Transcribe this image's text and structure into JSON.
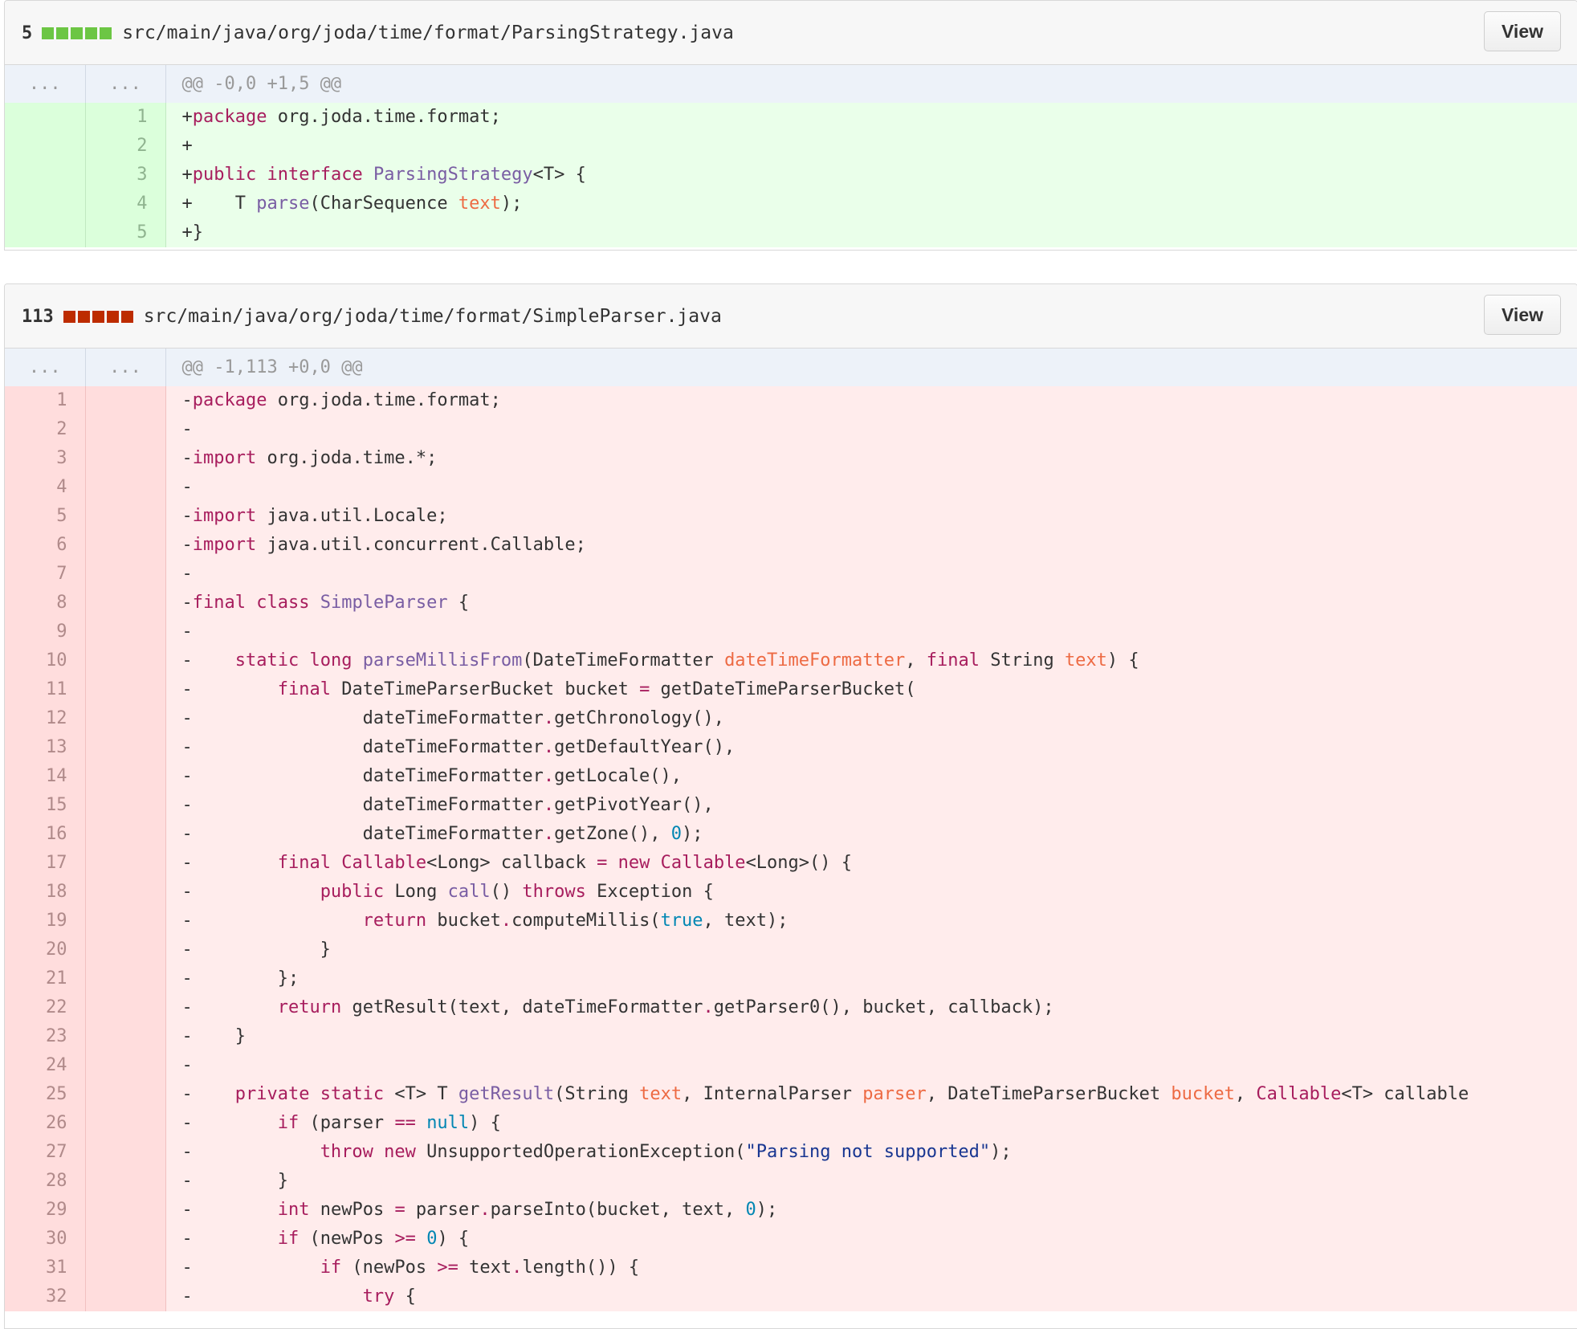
{
  "files": [
    {
      "count": "5",
      "path": "src/main/java/org/joda/time/format/ParsingStrategy.java",
      "view_label": "View",
      "block_color": "#6cc644",
      "hunk": "@@ -0,0 +1,5 @@",
      "hunk_old": "...",
      "hunk_new": "...",
      "lines": [
        {
          "old": "",
          "new": "1",
          "text": "+package org.joda.time.format;"
        },
        {
          "old": "",
          "new": "2",
          "text": "+"
        },
        {
          "old": "",
          "new": "3",
          "text": "+public interface ParsingStrategy<T> {"
        },
        {
          "old": "",
          "new": "4",
          "text": "+    T parse(CharSequence text);"
        },
        {
          "old": "",
          "new": "5",
          "text": "+}"
        }
      ]
    },
    {
      "count": "113",
      "path": "src/main/java/org/joda/time/format/SimpleParser.java",
      "view_label": "View",
      "block_color": "#bd2c00",
      "hunk": "@@ -1,113 +0,0 @@",
      "hunk_old": "...",
      "hunk_new": "...",
      "lines": [
        {
          "old": "1",
          "new": "",
          "text": "-package org.joda.time.format;"
        },
        {
          "old": "2",
          "new": "",
          "text": "-"
        },
        {
          "old": "3",
          "new": "",
          "text": "-import org.joda.time.*;"
        },
        {
          "old": "4",
          "new": "",
          "text": "-"
        },
        {
          "old": "5",
          "new": "",
          "text": "-import java.util.Locale;"
        },
        {
          "old": "6",
          "new": "",
          "text": "-import java.util.concurrent.Callable;"
        },
        {
          "old": "7",
          "new": "",
          "text": "-"
        },
        {
          "old": "8",
          "new": "",
          "text": "-final class SimpleParser {"
        },
        {
          "old": "9",
          "new": "",
          "text": "-"
        },
        {
          "old": "10",
          "new": "",
          "text": "-    static long parseMillisFrom(DateTimeFormatter dateTimeFormatter, final String text) {"
        },
        {
          "old": "11",
          "new": "",
          "text": "-        final DateTimeParserBucket bucket = getDateTimeParserBucket("
        },
        {
          "old": "12",
          "new": "",
          "text": "-                dateTimeFormatter.getChronology(),"
        },
        {
          "old": "13",
          "new": "",
          "text": "-                dateTimeFormatter.getDefaultYear(),"
        },
        {
          "old": "14",
          "new": "",
          "text": "-                dateTimeFormatter.getLocale(),"
        },
        {
          "old": "15",
          "new": "",
          "text": "-                dateTimeFormatter.getPivotYear(),"
        },
        {
          "old": "16",
          "new": "",
          "text": "-                dateTimeFormatter.getZone(), 0);"
        },
        {
          "old": "17",
          "new": "",
          "text": "-        final Callable<Long> callback = new Callable<Long>() {"
        },
        {
          "old": "18",
          "new": "",
          "text": "-            public Long call() throws Exception {"
        },
        {
          "old": "19",
          "new": "",
          "text": "-                return bucket.computeMillis(true, text);"
        },
        {
          "old": "20",
          "new": "",
          "text": "-            }"
        },
        {
          "old": "21",
          "new": "",
          "text": "-        };"
        },
        {
          "old": "22",
          "new": "",
          "text": "-        return getResult(text, dateTimeFormatter.getParser0(), bucket, callback);"
        },
        {
          "old": "23",
          "new": "",
          "text": "-    }"
        },
        {
          "old": "24",
          "new": "",
          "text": "-"
        },
        {
          "old": "25",
          "new": "",
          "text": "-    private static <T> T getResult(String text, InternalParser parser, DateTimeParserBucket bucket, Callable<T> callable"
        },
        {
          "old": "26",
          "new": "",
          "text": "-        if (parser == null) {"
        },
        {
          "old": "27",
          "new": "",
          "text": "-            throw new UnsupportedOperationException(\"Parsing not supported\");"
        },
        {
          "old": "28",
          "new": "",
          "text": "-        }"
        },
        {
          "old": "29",
          "new": "",
          "text": "-        int newPos = parser.parseInto(bucket, text, 0);"
        },
        {
          "old": "30",
          "new": "",
          "text": "-        if (newPos >= 0) {"
        },
        {
          "old": "31",
          "new": "",
          "text": "-            if (newPos >= text.length()) {"
        },
        {
          "old": "32",
          "new": "",
          "text": "-                try {"
        }
      ]
    }
  ]
}
